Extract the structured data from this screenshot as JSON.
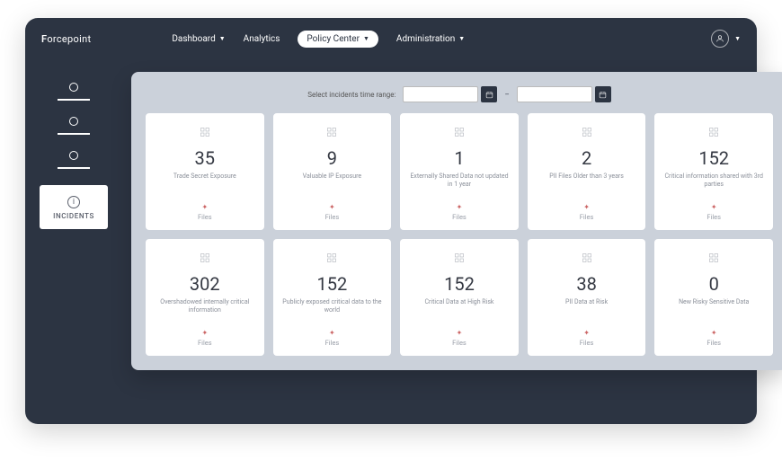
{
  "brand": {
    "prefix": "F",
    "suffix": "orcepoint"
  },
  "nav": [
    {
      "label": "Dashboard",
      "has_caret": true,
      "active": false
    },
    {
      "label": "Analytics",
      "has_caret": false,
      "active": false
    },
    {
      "label": "Policy Center",
      "has_caret": true,
      "active": true
    },
    {
      "label": "Administration",
      "has_caret": true,
      "active": false
    }
  ],
  "sidebar": {
    "placeholders": [
      {},
      {},
      {}
    ],
    "incidents": {
      "label": "INCIDENTS"
    }
  },
  "range": {
    "label": "Select incidents time range:",
    "start": "",
    "end": ""
  },
  "cards": [
    {
      "value": "35",
      "title": "Trade Secret Exposure",
      "footer": "Files"
    },
    {
      "value": "9",
      "title": "Valuable IP Exposure",
      "footer": "Files"
    },
    {
      "value": "1",
      "title": "Externally Shared Data not updated in 1 year",
      "footer": "Files"
    },
    {
      "value": "2",
      "title": "PII Files Older than 3 years",
      "footer": "Files"
    },
    {
      "value": "152",
      "title": "Critical information shared with 3rd parties",
      "footer": "Files"
    },
    {
      "value": "302",
      "title": "Overshadowed internally critical information",
      "footer": "Files"
    },
    {
      "value": "152",
      "title": "Publicly exposed critical data to the world",
      "footer": "Files"
    },
    {
      "value": "152",
      "title": "Critical Data at High Risk",
      "footer": "Files"
    },
    {
      "value": "38",
      "title": "PII Data at Risk",
      "footer": "Files"
    },
    {
      "value": "0",
      "title": "New Risky Sensitive Data",
      "footer": "Files"
    }
  ]
}
